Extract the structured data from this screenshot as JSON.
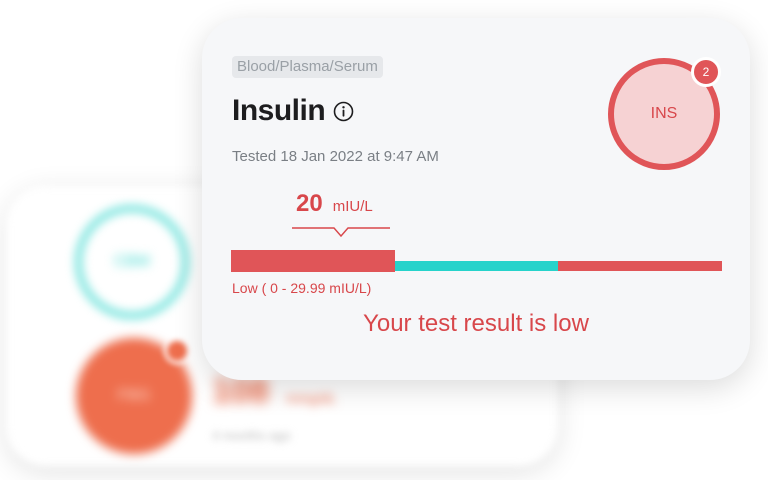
{
  "background_card": {
    "ring_label": "CBM",
    "circle_label": "FBG",
    "value": "108",
    "unit": "mmg/dL",
    "subtext": "4 months ago"
  },
  "card": {
    "category": "Blood/Plasma/Serum",
    "title": "Insulin",
    "tested": "Tested 18 Jan 2022 at 9:47 AM",
    "badge": {
      "label": "INS",
      "count": "2"
    },
    "result": {
      "value": "20",
      "unit": "mIU/L",
      "range_label": "Low ( 0 - 29.99 mIU/L)",
      "message": "Your test result is low"
    },
    "range_bar": {
      "segments": [
        "low",
        "normal",
        "high"
      ],
      "active_segment": "low"
    }
  },
  "colors": {
    "low": "#e05558",
    "normal": "#26d3cb",
    "high": "#e05558",
    "bg_ring": "#3fd8cf",
    "bg_circle": "#ee6e4d"
  },
  "icons": {
    "info": "info-icon"
  }
}
